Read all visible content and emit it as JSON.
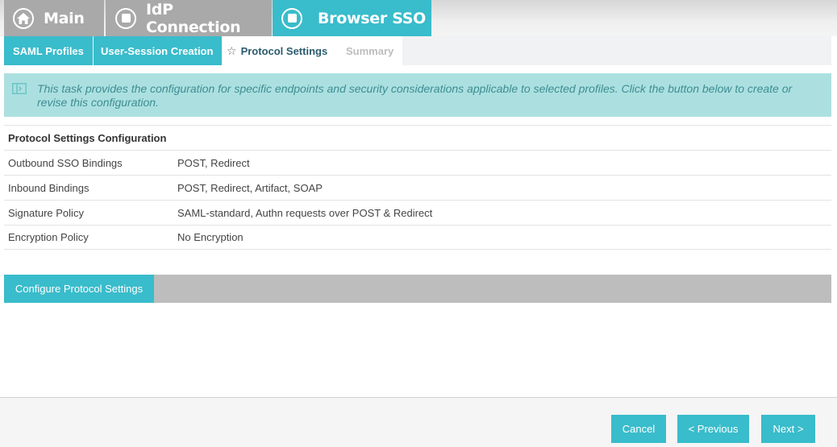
{
  "wizard_tabs": {
    "main": {
      "label": "Main",
      "icon": "home-icon"
    },
    "idp_connection": {
      "label": "IdP Connection",
      "icon": "square-circle-icon"
    },
    "browser_sso": {
      "label": "Browser SSO",
      "icon": "square-circle-icon"
    }
  },
  "sub_tabs": {
    "saml_profiles": "SAML Profiles",
    "user_session_creation": "User-Session Creation",
    "protocol_settings": "Protocol Settings",
    "summary": "Summary"
  },
  "info_banner": {
    "text": "This task provides the configuration for specific endpoints and security considerations applicable to selected profiles. Click the button below to create or revise this configuration."
  },
  "table": {
    "header": "Protocol Settings Configuration",
    "rows": [
      {
        "label": "Outbound SSO Bindings",
        "value": "POST, Redirect"
      },
      {
        "label": "Inbound Bindings",
        "value": "POST, Redirect, Artifact, SOAP"
      },
      {
        "label": "Signature Policy",
        "value": "SAML-standard, Authn requests over POST & Redirect"
      },
      {
        "label": "Encryption Policy",
        "value": "No Encryption"
      }
    ]
  },
  "actions": {
    "configure_label": "Configure Protocol Settings"
  },
  "footer": {
    "cancel_label": "Cancel",
    "previous_label": "< Previous",
    "next_label": "Next >"
  },
  "colors": {
    "accent": "#39bccb",
    "inactive_tab": "#a9a9a9",
    "banner": "#ace0e0",
    "banner_text": "#3d8d93"
  }
}
